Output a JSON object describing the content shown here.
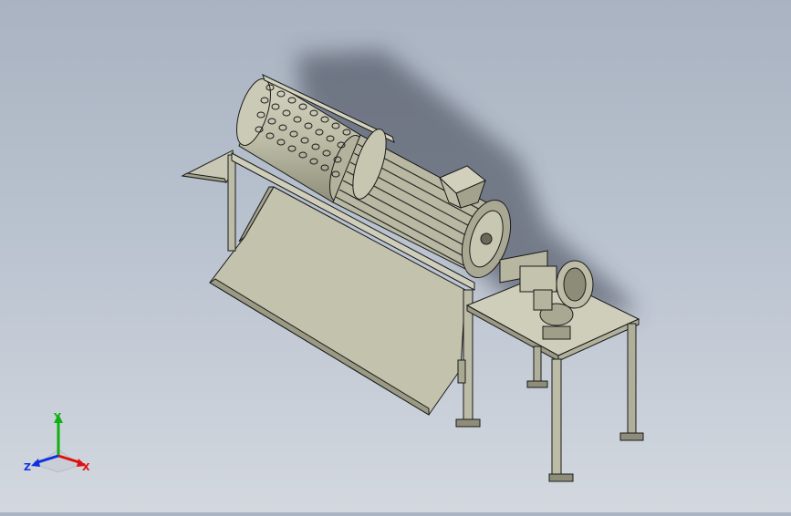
{
  "viewport": {
    "background_top": "#a9b3c1",
    "background_bottom": "#d3d8df",
    "model_color": "#c9c8b4",
    "edge_color": "#1a1a1a"
  },
  "triad": {
    "x_label": "X",
    "y_label": "Y",
    "z_label": "Z",
    "x_color": "#e01010",
    "y_color": "#10b010",
    "z_color": "#1030e0"
  }
}
